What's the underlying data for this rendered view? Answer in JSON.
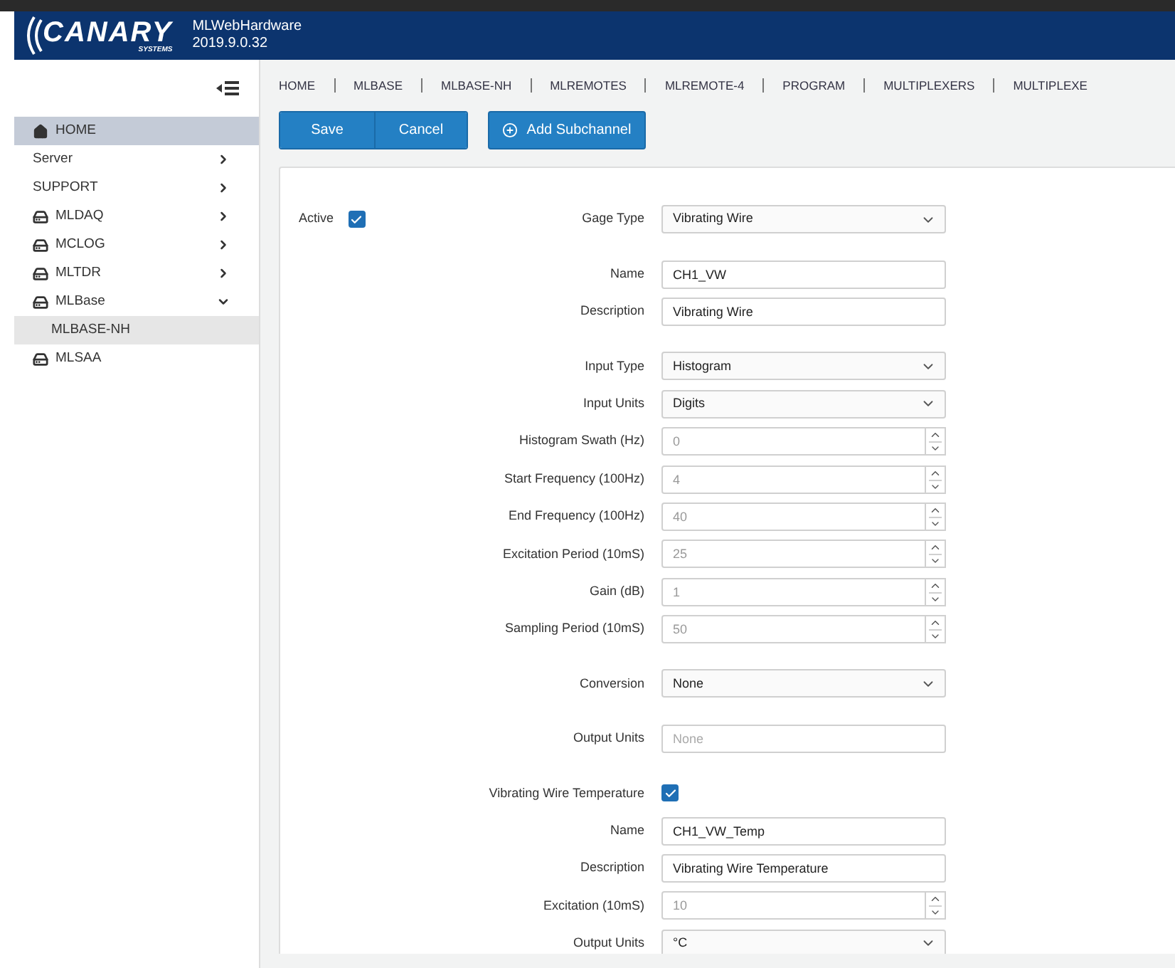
{
  "header": {
    "logo": "CANARY",
    "logo_sub": "SYSTEMS",
    "app_name": "MLWebHardware",
    "version": "2019.9.0.32"
  },
  "sidebar": {
    "items": [
      {
        "label": "HOME",
        "kind": "home",
        "selected": true
      },
      {
        "label": "Server",
        "kind": "plain",
        "selected": false,
        "expanded": false
      },
      {
        "label": "SUPPORT",
        "kind": "plain",
        "selected": false,
        "expanded": false
      },
      {
        "label": "MLDAQ",
        "kind": "device",
        "selected": false,
        "expanded": false
      },
      {
        "label": "MCLOG",
        "kind": "device",
        "selected": false,
        "expanded": false
      },
      {
        "label": "MLTDR",
        "kind": "device",
        "selected": false,
        "expanded": false
      },
      {
        "label": "MLBase",
        "kind": "device",
        "selected": false,
        "expanded": true,
        "children": [
          {
            "label": "MLBASE-NH",
            "selected": true
          }
        ]
      },
      {
        "label": "MLSAA",
        "kind": "device",
        "selected": false
      }
    ]
  },
  "breadcrumbs": [
    "HOME",
    "MLBASE",
    "MLBASE-NH",
    "MLREMOTES",
    "MLREMOTE-4",
    "PROGRAM",
    "MULTIPLEXERS",
    "MULTIPLEXE"
  ],
  "buttons": {
    "save": "Save",
    "cancel": "Cancel",
    "add": "Add Subchannel"
  },
  "active": {
    "label": "Active",
    "checked": true
  },
  "groups": [
    [
      {
        "kind": "select",
        "label": "Gage Type",
        "value": "Vibrating Wire"
      }
    ],
    [
      {
        "kind": "text",
        "label": "Name",
        "value": "CH1_VW"
      },
      {
        "kind": "text",
        "label": "Description",
        "value": "Vibrating Wire"
      }
    ],
    [
      {
        "kind": "select",
        "label": "Input Type",
        "value": "Histogram"
      },
      {
        "kind": "select",
        "label": "Input Units",
        "value": "Digits"
      },
      {
        "kind": "number",
        "label": "Histogram Swath (Hz)",
        "placeholder": "0"
      },
      {
        "kind": "number",
        "label": "Start Frequency (100Hz)",
        "placeholder": "4"
      },
      {
        "kind": "number",
        "label": "End Frequency (100Hz)",
        "placeholder": "40"
      },
      {
        "kind": "number",
        "label": "Excitation Period (10mS)",
        "placeholder": "25"
      },
      {
        "kind": "number",
        "label": "Gain (dB)",
        "placeholder": "1"
      },
      {
        "kind": "number",
        "label": "Sampling Period (10mS)",
        "placeholder": "50"
      }
    ],
    [
      {
        "kind": "select",
        "label": "Conversion",
        "value": "None"
      }
    ],
    [
      {
        "kind": "text",
        "label": "Output Units",
        "placeholder": "None"
      }
    ],
    [
      {
        "kind": "checkbox",
        "label": "Vibrating Wire Temperature",
        "checked": true
      },
      {
        "kind": "text",
        "label": "Name",
        "value": "CH1_VW_Temp"
      },
      {
        "kind": "text",
        "label": "Description",
        "value": "Vibrating Wire Temperature"
      },
      {
        "kind": "number",
        "label": "Excitation (10mS)",
        "placeholder": "10"
      },
      {
        "kind": "select",
        "label": "Output Units",
        "value": "°C"
      }
    ]
  ]
}
